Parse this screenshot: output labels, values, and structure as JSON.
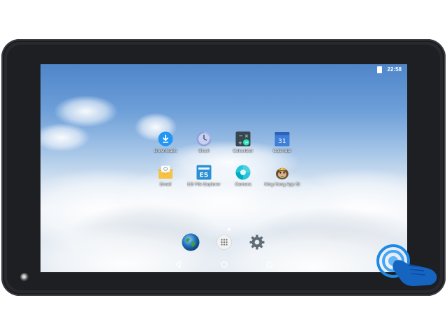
{
  "status_bar": {
    "time": "22:58"
  },
  "apps": [
    {
      "label": "Downloads",
      "icon": "download-icon"
    },
    {
      "label": "Clock",
      "icon": "clock-icon"
    },
    {
      "label": "Calculator",
      "icon": "calculator-icon"
    },
    {
      "label": "Calendar",
      "icon": "calendar-icon",
      "day": "31"
    },
    {
      "label": "Email",
      "icon": "email-icon"
    },
    {
      "label": "ES File Explorer",
      "icon": "es-file-explorer-icon"
    },
    {
      "label": "Camera",
      "icon": "camera-icon"
    },
    {
      "label": "King Kong App St",
      "icon": "king-kong-app-store-icon"
    }
  ],
  "dock": [
    {
      "icon": "browser-globe-icon"
    },
    {
      "icon": "app-drawer-icon"
    },
    {
      "icon": "settings-gear-icon"
    }
  ],
  "navigation": [
    {
      "icon": "back-icon"
    },
    {
      "icon": "home-icon"
    },
    {
      "icon": "recents-icon"
    }
  ],
  "colors": {
    "download_blue": "#2196f3",
    "calendar_blue": "#3f7fd8",
    "calculator_dark": "#37474f",
    "calculator_green": "#1de9b6",
    "email_yellow": "#f6c244",
    "touch_blue": "#1e88e5"
  }
}
